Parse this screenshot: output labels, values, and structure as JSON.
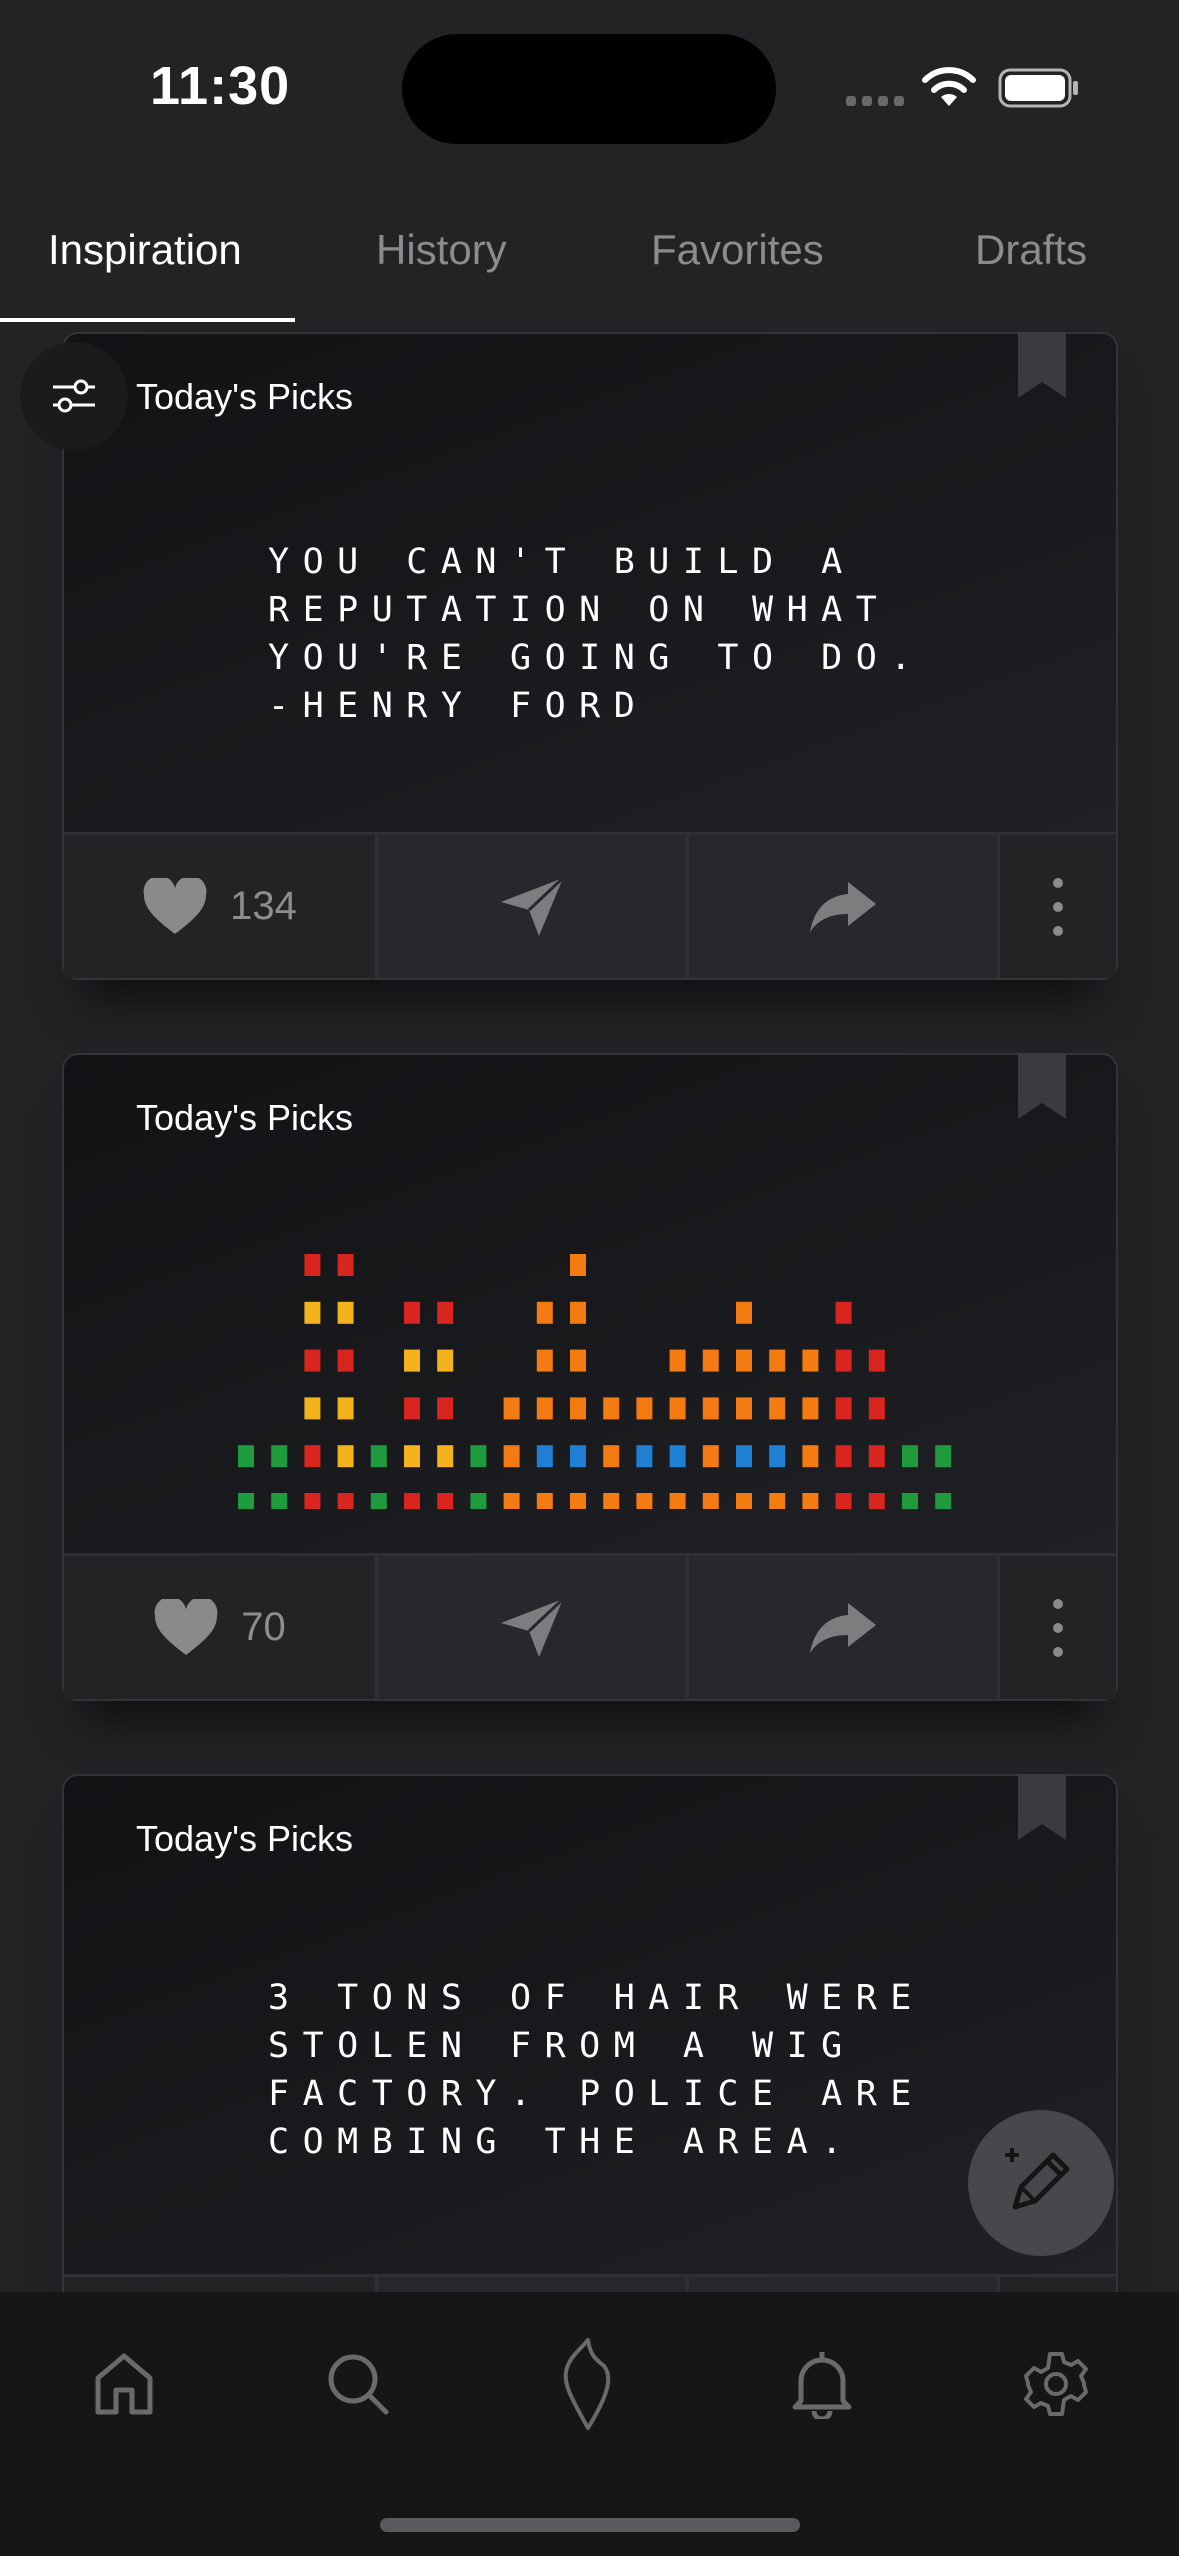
{
  "status_bar": {
    "time": "11:30"
  },
  "tabs": [
    {
      "label": "Inspiration",
      "active": true
    },
    {
      "label": "History",
      "active": false
    },
    {
      "label": "Favorites",
      "active": false
    },
    {
      "label": "Drafts",
      "active": false
    }
  ],
  "cards": [
    {
      "label": "Today's Picks",
      "type": "quote",
      "text": "YOU CAN'T BUILD A\nREPUTATION ON WHAT\nYOU'RE GOING TO DO.\n-HENRY FORD",
      "likes": "134"
    },
    {
      "label": "Today's Picks",
      "type": "pixel-art",
      "likes": "70"
    },
    {
      "label": "Today's Picks",
      "type": "quote",
      "text": "3 TONS OF HAIR WERE\nSTOLEN FROM A WIG\nFACTORY. POLICE ARE\nCOMBING THE AREA."
    }
  ],
  "icons": {
    "filter": "sliders-icon",
    "compose": "compose-pencil-icon",
    "nav": [
      "home-icon",
      "search-icon",
      "flame-icon",
      "bell-icon",
      "gear-icon"
    ]
  },
  "colors": {
    "background": "#222325",
    "card": "#1a1b1e",
    "muted": "#8d8d90",
    "pixel_green": "#1f9a3c",
    "pixel_red": "#d9251f",
    "pixel_yellow": "#f4b31c",
    "pixel_orange": "#f47a12",
    "pixel_blue": "#1f7fd3"
  }
}
